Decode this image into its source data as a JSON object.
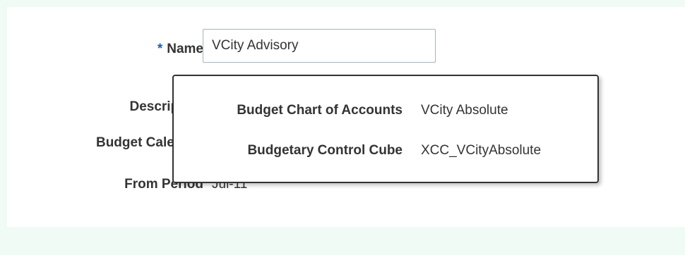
{
  "form": {
    "name_required_marker": "*",
    "name_label": "Name",
    "name_value": "VCity Advisory",
    "description_label": "Description",
    "budget_calendar_label": "Budget Calendar",
    "from_period_label": "From Period",
    "from_period_value": "Jul-11"
  },
  "popup": {
    "rows": [
      {
        "label": "Budget Chart of Accounts",
        "value": "VCity Absolute"
      },
      {
        "label": "Budgetary Control Cube",
        "value": "XCC_VCityAbsolute"
      }
    ]
  },
  "colors": {
    "background": "#f1fbf5",
    "panel": "#ffffff",
    "required_marker": "#1f5fb2",
    "text": "#333333",
    "popup_border": "#333333"
  }
}
